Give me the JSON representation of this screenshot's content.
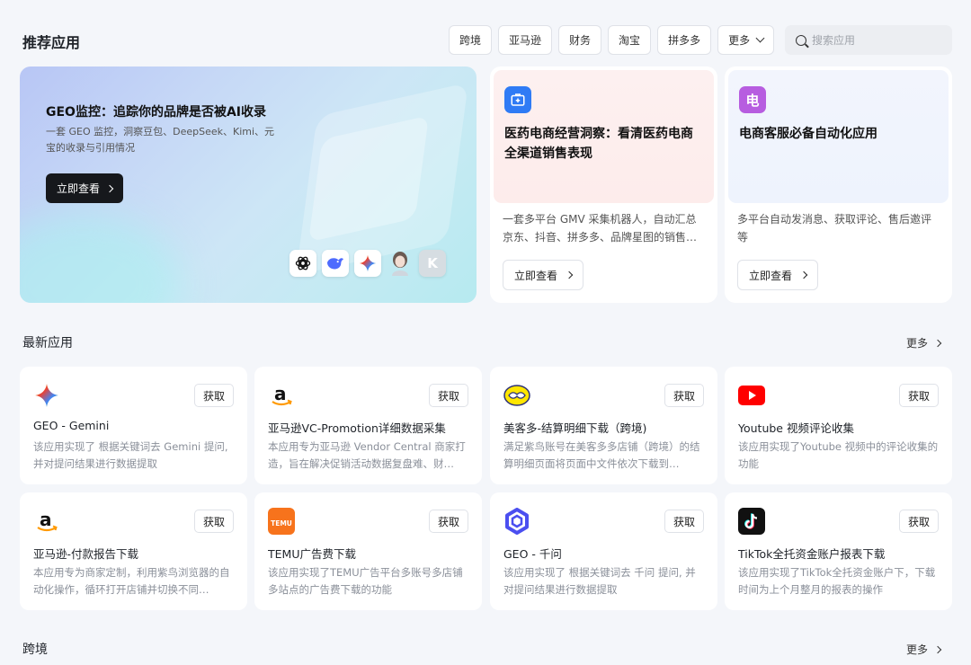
{
  "header": {
    "title": "推荐应用",
    "filters": [
      "跨境",
      "亚马逊",
      "财务",
      "淘宝",
      "拼多多"
    ],
    "more_label": "更多",
    "search_placeholder": "搜索应用"
  },
  "hero": {
    "title": "GEO监控：追踪你的品牌是否被AI收录",
    "desc": "一套 GEO 监控，洞察豆包、DeepSeek、Kimi、元宝的收录与引用情况",
    "button": "立即查看",
    "icons": [
      "chatgpt-icon",
      "deepseek-icon",
      "gemini-icon",
      "avatar-icon",
      "kimi-icon"
    ],
    "kimi_letter": "K"
  },
  "featured": [
    {
      "icon_char": "",
      "title": "医药电商经营洞察：看清医药电商全渠道销售表现",
      "desc": "一套多平台 GMV 采集机器人，自动汇总京东、抖音、拼多多、品牌星图的销售…",
      "button": "立即查看"
    },
    {
      "icon_char": "电",
      "title": "电商客服必备自动化应用",
      "desc": "多平台自动发消息、获取评论、售后邀评等",
      "button": "立即查看"
    }
  ],
  "latest": {
    "title": "最新应用",
    "more": "更多"
  },
  "apps": [
    {
      "name": "GEO - Gemini",
      "desc": "该应用实现了 根据关键词去 Gemini 提问, 并对提问结果进行数据提取",
      "get": "获取"
    },
    {
      "name": "亚马逊VC-Promotion详细数据采集",
      "desc": "本应用专为亚马逊 Vendor Central 商家打造，旨在解决促销活动数据复盘难、财…",
      "get": "获取"
    },
    {
      "name": "美客多-结算明细下载（跨境)",
      "desc": "满足紫鸟账号在美客多多店铺（跨境）的结算明细页面将页面中文件依次下载到…",
      "get": "获取"
    },
    {
      "name": "Youtube 视频评论收集",
      "desc": "该应用实现了Youtube 视频中的评论收集的功能",
      "get": "获取"
    },
    {
      "name": "亚马逊-付款报告下载",
      "desc": "本应用专为商家定制，利用紫鸟浏览器的自动化操作，循环打开店铺并切换不同…",
      "get": "获取"
    },
    {
      "name": "TEMU广告费下载",
      "desc": "该应用实现了TEMU广告平台多账号多店铺多站点的广告费下载的功能",
      "get": "获取"
    },
    {
      "name": "GEO - 千问",
      "desc": "该应用实现了 根据关键词去 千问 提问, 并对提问结果进行数据提取",
      "get": "获取"
    },
    {
      "name": "TikTok全托资金账户报表下载",
      "desc": "该应用实现了TikTok全托资金账户下，下载时间为上个月整月的报表的操作",
      "get": "获取"
    }
  ],
  "crossborder": {
    "title": "跨境",
    "more": "更多"
  },
  "icon_texts": {
    "temu": "TEMU",
    "amazon_letter": "a"
  },
  "colors": {
    "accent_blue": "#2f7bf5",
    "accent_purple": "#b75de0",
    "youtube_red": "#ff0000",
    "temu_orange": "#f7731c"
  }
}
